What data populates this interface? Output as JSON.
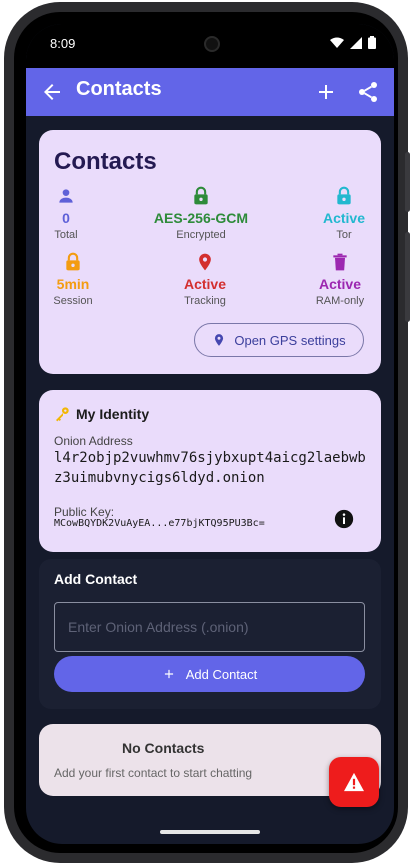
{
  "status_bar": {
    "time": "8:09"
  },
  "app_bar": {
    "title": "Contacts"
  },
  "stats": {
    "title": "Contacts",
    "items": [
      {
        "icon": "person-icon",
        "value": "0",
        "label": "Total",
        "color": "#5e60d8"
      },
      {
        "icon": "lock-icon",
        "value": "AES-256-GCM",
        "label": "Encrypted",
        "color": "#2e8b3a"
      },
      {
        "icon": "lock-icon",
        "value": "Active",
        "label": "Tor",
        "color": "#22b8cf"
      },
      {
        "icon": "lock-icon",
        "value": "5min",
        "label": "Session",
        "color": "#f39c12"
      },
      {
        "icon": "location-pin-icon",
        "value": "Active",
        "label": "Tracking",
        "color": "#d32f2f"
      },
      {
        "icon": "trash-icon",
        "value": "Active",
        "label": "RAM-only",
        "color": "#9c27b0"
      }
    ],
    "gps_button": "Open GPS settings"
  },
  "identity": {
    "title": "My Identity",
    "onion_label": "Onion Address",
    "onion_address": "l4r2objp2vuwhmv76sjybxupt4aicg2laebwbz3uimubvnycigs6ldyd.onion",
    "pubkey_label": "Public Key:",
    "pubkey": "MCowBQYDK2VuAyEA...e77bjKTQ95PU3Bc="
  },
  "add_contact": {
    "title": "Add Contact",
    "input_placeholder": "Enter Onion Address (.onion)",
    "input_value": "",
    "button_label": "Add Contact"
  },
  "empty_state": {
    "title": "No Contacts",
    "subtitle": "Add your first contact to start chatting"
  },
  "colors": {
    "accent": "#6265e8",
    "background": "#151a2b",
    "card": "#eadcfb",
    "panic": "#ee1c1c"
  }
}
